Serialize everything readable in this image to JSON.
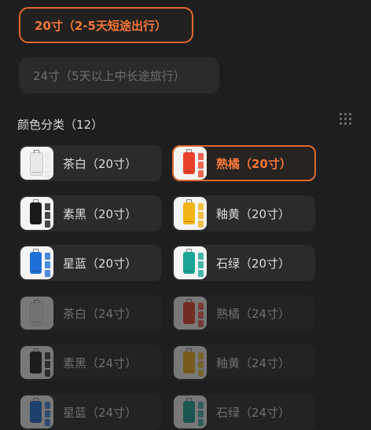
{
  "size_options": [
    {
      "label": "20寸（2-5天短途出行）",
      "selected": true
    },
    {
      "label": "24寸（5天以上中长途旅行）",
      "selected": false
    }
  ],
  "color_section": {
    "title": "颜色分类（12）"
  },
  "colors": {
    "accent": "#e0662f",
    "background": "#1e1e1f",
    "tile": "#2b2b2d"
  },
  "color_items": [
    {
      "label": "茶白（20寸）",
      "swatch": "#e8e8e8",
      "selected": false,
      "disabled": false
    },
    {
      "label": "熟橘（20寸）",
      "swatch": "#e8422a",
      "selected": true,
      "disabled": false
    },
    {
      "label": "素黑（20寸）",
      "swatch": "#1a1a1a",
      "selected": false,
      "disabled": false
    },
    {
      "label": "釉黄（20寸）",
      "swatch": "#f2b516",
      "selected": false,
      "disabled": false
    },
    {
      "label": "星蓝（20寸）",
      "swatch": "#1f6fd6",
      "selected": false,
      "disabled": false
    },
    {
      "label": "石绿（20寸）",
      "swatch": "#1aa596",
      "selected": false,
      "disabled": false
    },
    {
      "label": "茶白（24寸）",
      "swatch": "#e8e8e8",
      "selected": false,
      "disabled": true
    },
    {
      "label": "熟橘（24寸）",
      "swatch": "#e8422a",
      "selected": false,
      "disabled": true
    },
    {
      "label": "素黑（24寸）",
      "swatch": "#1a1a1a",
      "selected": false,
      "disabled": true
    },
    {
      "label": "釉黄（24寸）",
      "swatch": "#f2b516",
      "selected": false,
      "disabled": true
    },
    {
      "label": "星蓝（24寸）",
      "swatch": "#1f6fd6",
      "selected": false,
      "disabled": true
    },
    {
      "label": "石绿（24寸）",
      "swatch": "#1aa596",
      "selected": false,
      "disabled": true
    }
  ],
  "icons": {
    "layout_toggle": "grid-icon"
  }
}
